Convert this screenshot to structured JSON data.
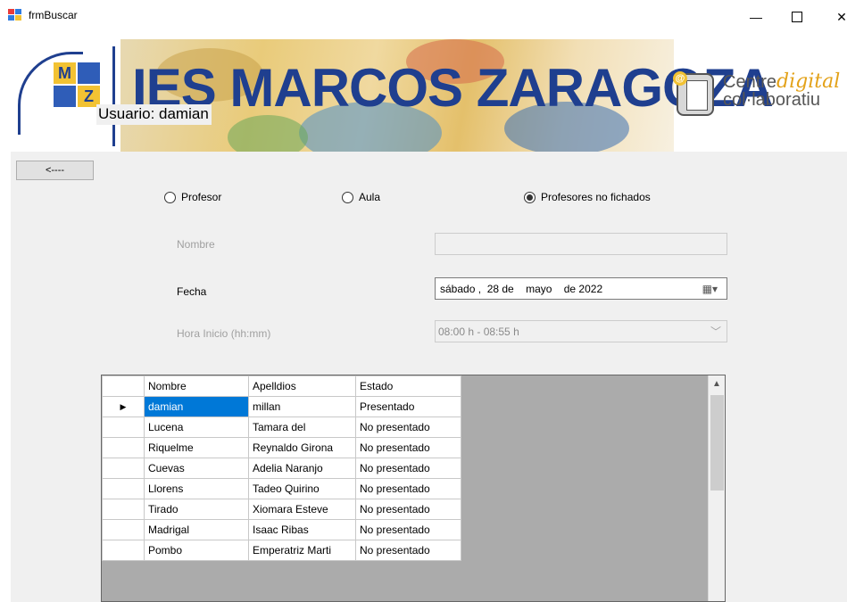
{
  "window": {
    "title": "frmBuscar",
    "minimize_glyph": "—",
    "close_glyph": "✕"
  },
  "banner": {
    "title": "IES MARCOS ZARAGOZA",
    "logo_letter_m": "M",
    "logo_letter_z": "Z",
    "usuario": "Usuario: damian",
    "cd_word1": "Centre",
    "cd_word2": "digital",
    "cd_line2": "col·laboratiu",
    "colors": {
      "title": "#1f3f8f",
      "digital": "#e3a21a"
    }
  },
  "back_button": {
    "label": "<----"
  },
  "radios": [
    {
      "label": "Profesor",
      "checked": false
    },
    {
      "label": "Aula",
      "checked": false
    },
    {
      "label": "Profesores no fichados",
      "checked": true
    }
  ],
  "form": {
    "nombre_label": "Nombre",
    "nombre_value": "",
    "fecha_label": "Fecha",
    "fecha_value": "sábado ,  28 de    mayo    de 2022",
    "hora_label": "Hora Inicio (hh:mm)",
    "hora_value": "08:00 h - 08:55 h"
  },
  "grid": {
    "columns": [
      "Nombre",
      "Apelldios",
      "Estado"
    ],
    "rows": [
      [
        "damian",
        "millan",
        "Presentado"
      ],
      [
        "Lucena",
        "Tamara del",
        "No presentado"
      ],
      [
        "Riquelme",
        "Reynaldo Girona",
        "No presentado"
      ],
      [
        "Cuevas",
        "Adelia Naranjo",
        "No presentado"
      ],
      [
        "Llorens",
        "Tadeo Quirino",
        "No presentado"
      ],
      [
        "Tirado",
        "Xiomara Esteve",
        "No presentado"
      ],
      [
        "Madrigal",
        "Isaac Ribas",
        "No presentado"
      ],
      [
        "Pombo",
        "Emperatriz Marti",
        "No presentado"
      ]
    ],
    "current_row_marker": "▶",
    "selected_row": 0
  }
}
